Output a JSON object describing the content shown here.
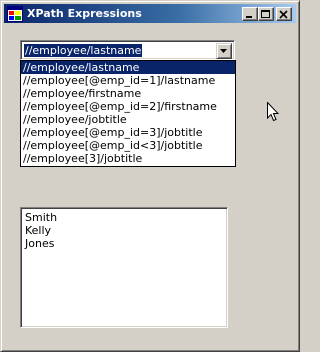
{
  "window": {
    "title": "XPath Expressions",
    "icon": "app-window-icon",
    "titlebar_colors": [
      "#0a246a",
      "#a6caf0"
    ]
  },
  "combo": {
    "selected_value": "//employee/lastname"
  },
  "dropdown": {
    "items": [
      "//employee/lastname",
      "//employee[@emp_id=1]/lastname",
      "//employee/firstname",
      "//employee[@emp_id=2]/firstname",
      "//employee/jobtitle",
      "//employee[@emp_id=3]/jobtitle",
      "//employee[@emp_id<3]/jobtitle",
      "//employee[3]/jobtitle"
    ],
    "selected_index": 0
  },
  "results": {
    "items": [
      "Smith",
      "Kelly",
      "Jones"
    ]
  },
  "icons": {
    "minimize": "minimize-icon",
    "maximize": "maximize-icon",
    "close": "close-icon",
    "dropdown_arrow": "chevron-down-icon",
    "cursor": "mouse-pointer-icon"
  },
  "colors": {
    "selection": "#0a246a",
    "face": "#d4d0c8"
  }
}
